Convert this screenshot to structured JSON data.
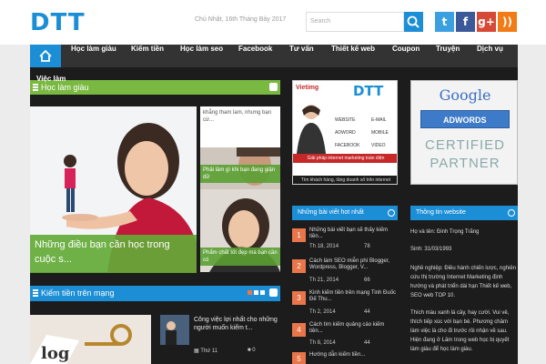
{
  "header": {
    "logo": "DTT",
    "date": "Chủ Nhật, 16th Tháng Bảy 2017",
    "search_placeholder": "Search"
  },
  "social": [
    {
      "name": "twitter-icon",
      "glyph": "t",
      "color": "#3aa0e0"
    },
    {
      "name": "facebook-icon",
      "glyph": "f",
      "color": "#3b5998"
    },
    {
      "name": "google-plus-icon",
      "glyph": "g+",
      "color": "#d64937"
    },
    {
      "name": "rss-icon",
      "glyph": "))",
      "color": "#f07b17"
    }
  ],
  "nav": {
    "items": [
      "Học làm giàu",
      "Kiếm tiền",
      "Học làm seo",
      "Facebook",
      "Tư vấn",
      "Thiết kế web",
      "Coupon",
      "Truyện",
      "Dịch vụ"
    ]
  },
  "main": {
    "overlap_title": "Việc làm",
    "section1_title": "Học làm giàu",
    "featured_caption": "Những điều bạn cần học trong cuộc s...",
    "side_text": "khẳng tham lam, nhưng bạn cứ...",
    "side_caption1": "Phải làm gì khi bạn đang giận dữ",
    "side_caption2": "Phẩm chất tốt đẹp mà bạn cần có",
    "section2_title": "Kiếm tiền trên mạng",
    "article_title": "Công việc lợi nhất cho những người muốn kiếm t...",
    "article_date": "Thứ 11",
    "article_count": "0"
  },
  "middle": {
    "ad_brand": "Vietimg",
    "ad_logo": "DTT",
    "ad_items": [
      "WEBSITE",
      "E-MAIL",
      "ADWORD",
      "MOBILE",
      "FACEBOOK",
      "VIDEO"
    ],
    "ad_banner": "Giải pháp internet marketing toàn diện",
    "ad_subtext": "Tìm khách hàng, tăng doanh số trên internet",
    "hot_title": "Những bài viết hot nhất",
    "hot_posts": [
      {
        "num": "1",
        "title": "Những bài viết bạn sẽ thấy kiếm tiền...",
        "date": "Th 18, 2014",
        "count": "78"
      },
      {
        "num": "2",
        "title": "Cách làm SEO miễn phí Blogger, Wordpress, Blogger, V...",
        "date": "Th 21, 2014",
        "count": "66"
      },
      {
        "num": "3",
        "title": "Kinh kiếm tiền trên mạng Tinh Đuốc Đế Thu...",
        "date": "Th 2, 2014",
        "count": "44"
      },
      {
        "num": "4",
        "title": "Cách tìm kiếm quảng cáo kiếm tiền...",
        "date": "Th 8, 2014",
        "count": "44"
      },
      {
        "num": "5",
        "title": "Hướng dẫn kiếm tiền...",
        "date": "",
        "count": ""
      }
    ]
  },
  "right": {
    "google_line1": "Google",
    "google_line2": "ADWORDS",
    "google_line3": "CERTIFIED",
    "google_line4": "PARTNER",
    "info_title": "Thông tin website",
    "info_lines": [
      "Họ và tên: Đinh Trọng Trãng",
      "Sinh: 31/03/1993",
      "Nghề nghiệp: Điều hành chiến lược, nghiên cứu thị trường Internet Marketing định hướng và phát triển dài hạn Thiết kế web, SEO web TOP 10.",
      "Thích màu xanh lá cây, hay cười. Vui vẻ, thích tiếp xúc với bạn bè. Phương châm làm việc là cho đi trước rồi nhận về sau. Hiện đang ở Lâm trong web học bị quyết làm giàu để học làm giàu."
    ]
  }
}
